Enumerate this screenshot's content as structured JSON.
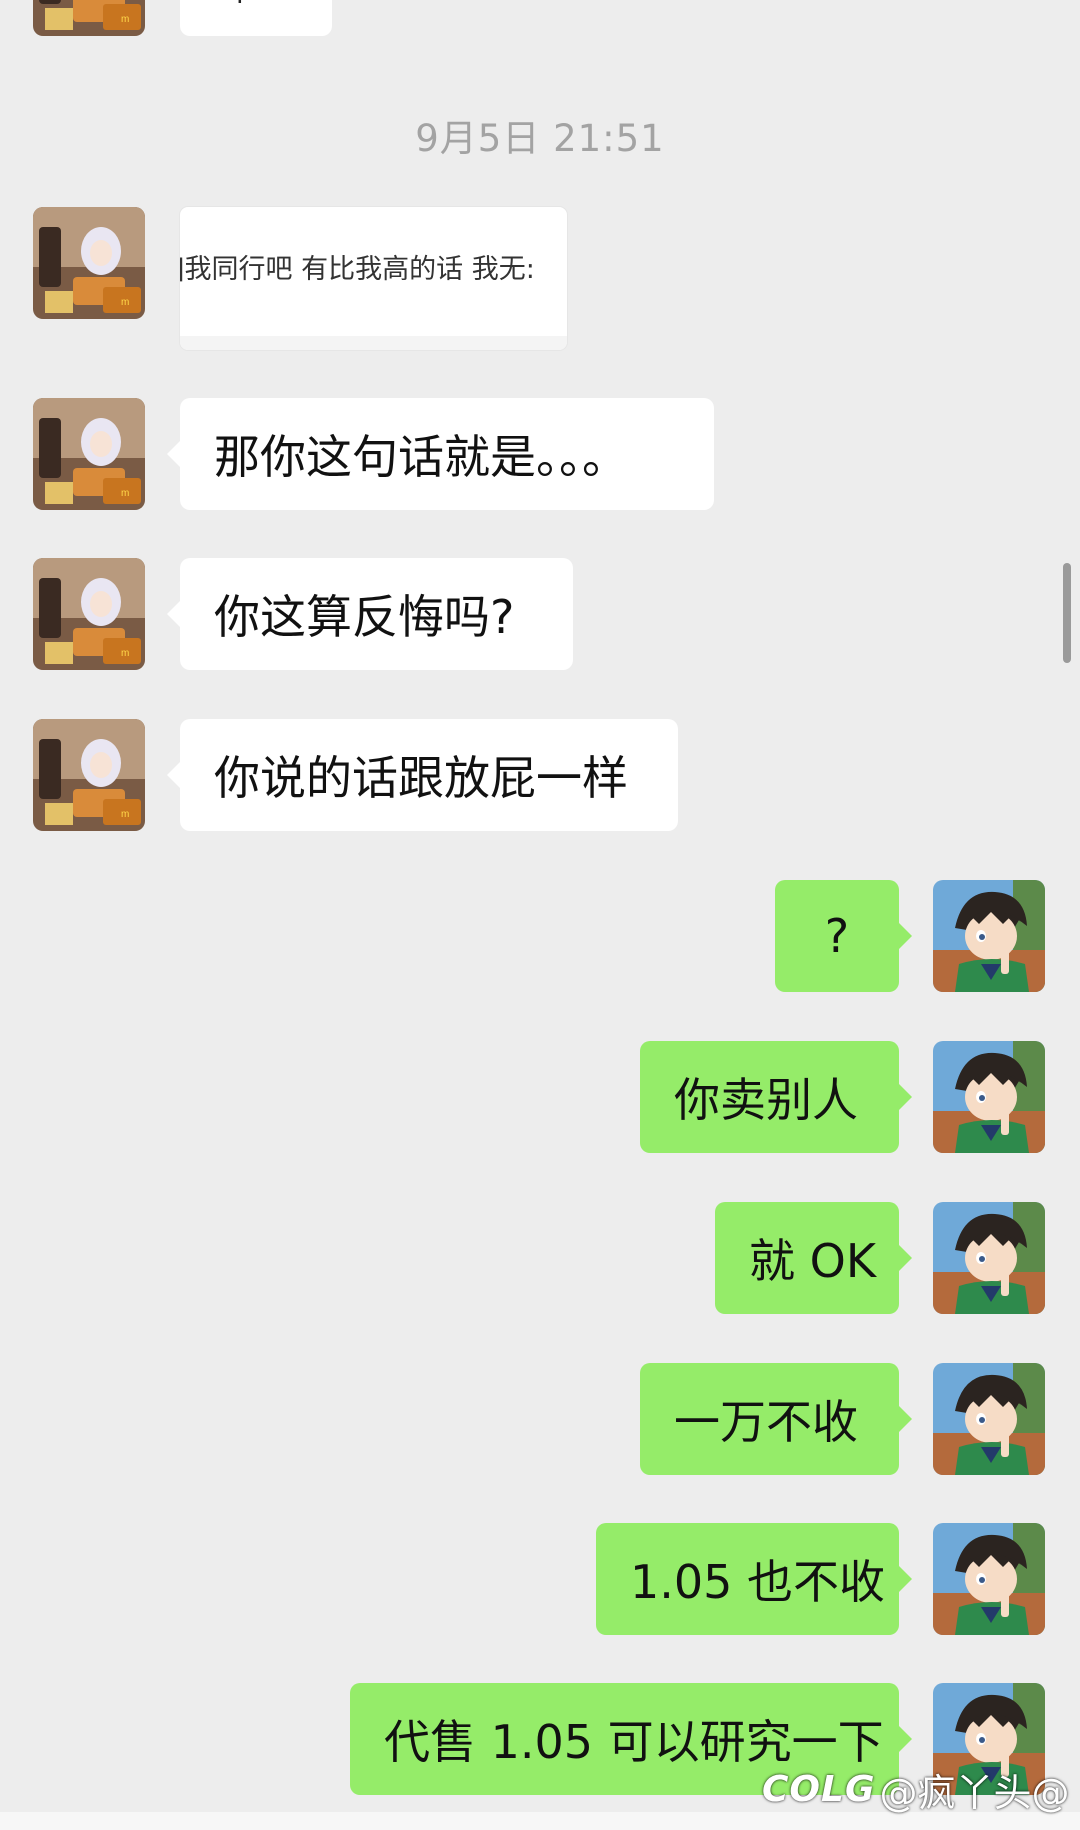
{
  "timestamp": "9月5日 21:51",
  "top_partial": {
    "text": "·"
  },
  "quoted_message": "]我同行吧 有比我高的话 我无:",
  "incoming": [
    {
      "text": "那你这句话就是。。。"
    },
    {
      "text": "你这算反悔吗?"
    },
    {
      "text": "你说的话跟放屁一样"
    }
  ],
  "outgoing": [
    {
      "text": "?"
    },
    {
      "text": "你卖别人"
    },
    {
      "text": "就 OK"
    },
    {
      "text": "一万不收"
    },
    {
      "text": "1.05 也不收"
    },
    {
      "text": "代售 1.05 可以研究一下"
    }
  ],
  "watermark": {
    "brand": "COLG",
    "handle": "@疯丫头@"
  },
  "colors": {
    "background": "#ededed",
    "incoming_bubble": "#ffffff",
    "outgoing_bubble": "#95ec69",
    "timestamp_text": "#a3a3a3"
  },
  "avatars": {
    "contact": "anime-girl-avatar",
    "self": "detective-boy-avatar"
  }
}
